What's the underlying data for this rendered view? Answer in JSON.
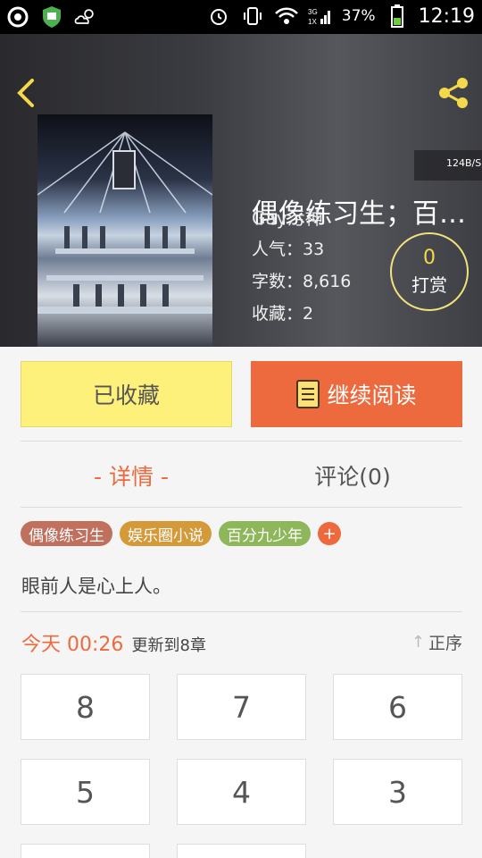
{
  "status_bar": {
    "time": "12:19",
    "battery_percent": "37%",
    "network_label": "3G\n1X",
    "icons": [
      "netease-icon",
      "shield-app-icon",
      "weather-cloud-icon",
      "alarm-icon",
      "vibrate-icon",
      "wifi-icon",
      "signal-icon",
      "battery-icon"
    ]
  },
  "header": {
    "back_icon": "chevron-left-icon",
    "share_icon": "share-icon",
    "title": "偶像练习生；百…",
    "author": "Gay污神",
    "popularity_label": "人气：33",
    "wordcount_label": "字数：8,616",
    "favorites_label": "收藏：2",
    "net_speed": "124B/S",
    "reward": {
      "count": "0",
      "label": "打赏"
    },
    "accent_color": "#f4d94a"
  },
  "actions": {
    "collected_label": "已收藏",
    "continue_label": "继续阅读",
    "collected_bg": "#fdf17b",
    "continue_bg": "#ec6a3d"
  },
  "tabs": {
    "detail_label": "- 详情 -",
    "comments_label": "评论(0)"
  },
  "tags": [
    {
      "label": "偶像练习生",
      "color": "#c1705e"
    },
    {
      "label": "娱乐圈小说",
      "color": "#d49a3a"
    },
    {
      "label": "百分九少年",
      "color": "#8eb65a"
    }
  ],
  "tag_add_label": "+",
  "description": "眼前人是心上人。",
  "update": {
    "time": "今天 00:26",
    "text": "更新到8章",
    "sort_label": "正序",
    "sort_icon": "arrow-up-icon"
  },
  "chapters": [
    "8",
    "7",
    "6",
    "5",
    "4",
    "3",
    "",
    ""
  ]
}
